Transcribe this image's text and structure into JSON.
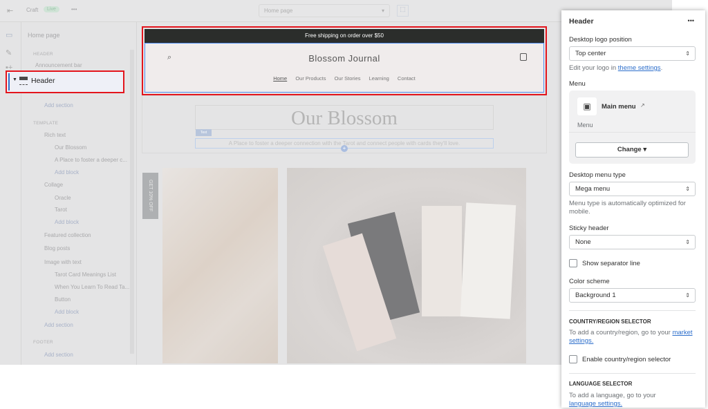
{
  "topbar": {
    "app": "Craft",
    "badge": "Live",
    "more": "•••",
    "page_select": "Home page"
  },
  "sidebar": {
    "title": "Home page",
    "header_section": "HEADER",
    "announcement": "Announcement bar",
    "header": "Header",
    "add_section": "Add section",
    "template_section": "TEMPLATE",
    "rich_text": "Rich text",
    "our_blossom": "Our Blossom",
    "a_place": "A Place to foster a deeper c...",
    "add_block": "Add block",
    "collage": "Collage",
    "oracle": "Oracle",
    "tarot": "Tarot",
    "featured": "Featured collection",
    "blog": "Blog posts",
    "image_text": "Image with text",
    "tarot_list": "Tarot Card Meanings List",
    "when_you": "When You Learn To Read Ta...",
    "button": "Button",
    "footer_section": "FOOTER"
  },
  "preview": {
    "announcement": "Free shipping on order over $50",
    "store_name": "Blossom Journal",
    "nav": [
      "Home",
      "Our Products",
      "Our Stories",
      "Learning",
      "Contact"
    ],
    "heading": "Our Blossom",
    "text_tag": "Text",
    "subtext": "A Place to foster a deeper connection with the Tarot and connect people with cards they'll love.",
    "popup_tab": "GET 10% OFF"
  },
  "panel": {
    "title": "Header",
    "more": "•••",
    "logo_label": "Desktop logo position",
    "logo_value": "Top center",
    "logo_help": "Edit your logo in ",
    "logo_link": "theme settings",
    "menu_label": "Menu",
    "menu_name": "Main menu",
    "menu_sub": "Menu",
    "change": "Change ▾",
    "menu_type_label": "Desktop menu type",
    "menu_type_value": "Mega menu",
    "menu_type_help": "Menu type is automatically optimized for mobile.",
    "sticky_label": "Sticky header",
    "sticky_value": "None",
    "separator": "Show separator line",
    "color_label": "Color scheme",
    "color_value": "Background 1",
    "country_cap": "COUNTRY/REGION SELECTOR",
    "country_help": "To add a country/region, go to your ",
    "country_link": "market settings.",
    "country_cb": "Enable country/region selector",
    "lang_cap": "LANGUAGE SELECTOR",
    "lang_help": "To add a language, go to your",
    "lang_link": "language settings."
  }
}
